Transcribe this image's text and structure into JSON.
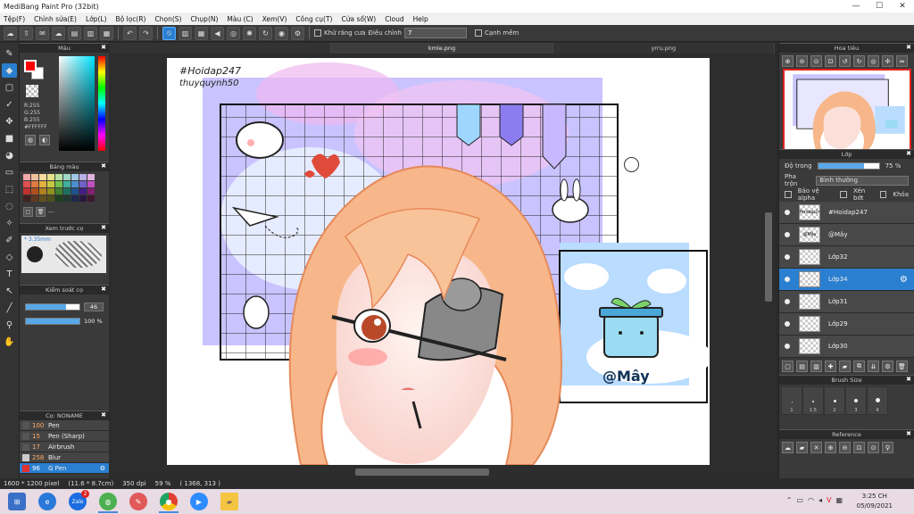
{
  "window": {
    "title": "MediBang Paint Pro (32bit)",
    "min": "—",
    "max": "☐",
    "close": "✕"
  },
  "menu": [
    "Tệp(F)",
    "Chỉnh sửa(E)",
    "Lớp(L)",
    "Bộ lọc(R)",
    "Chọn(S)",
    "Chụp(N)",
    "Màu (C)",
    "Xem(V)",
    "Công cụ(T)",
    "Cửa sổ(W)",
    "Cloud",
    "Help"
  ],
  "toolbar": {
    "antialias_label": "Khử răng cưa",
    "correction_label": "Điều chỉnh",
    "correction_value": "7",
    "snap_label": "Cạnh mềm"
  },
  "tabs": [
    {
      "label": ""
    },
    {
      "label": "kmle.png"
    },
    {
      "label": "yrru.png"
    }
  ],
  "color_panel": {
    "title": "Màu",
    "r": "R:255",
    "g": "G:255",
    "b": "B:255",
    "hex": "#FFFFFF"
  },
  "palette_panel": {
    "title": "Bảng màu",
    "name": "---"
  },
  "preview_panel": {
    "title": "Xem trước cọ",
    "size": "3.35mm"
  },
  "control_panel": {
    "title": "Kiểm soát cọ",
    "size_value": "46",
    "opacity_value": "100 %",
    "size_level": 0.75,
    "opacity_level": 1.0
  },
  "brush_panel": {
    "title": "Cọ: NONAME",
    "items": [
      {
        "size": "100",
        "name": "Pen",
        "color": "#555555",
        "active": false
      },
      {
        "size": "15",
        "name": "Pen (Sharp)",
        "color": "#555555",
        "active": false
      },
      {
        "size": "17",
        "name": "Airbrush",
        "color": "#555555",
        "active": false
      },
      {
        "size": "258",
        "name": "Blur",
        "color": "#cccccc",
        "active": false
      },
      {
        "size": "96",
        "name": "G Pen",
        "color": "#e03030",
        "active": true
      }
    ]
  },
  "artwork": {
    "watermark_1": "#Hoidap247",
    "watermark_2": "thuyquynh50",
    "sticker_text": "@Mây"
  },
  "navigator": {
    "title": "Hoa tiêu"
  },
  "layer_panel": {
    "title": "Lớp",
    "opacity_label": "Độ trong",
    "opacity_value": "75 %",
    "opacity_level": 0.75,
    "blend_label": "Pha trộn",
    "blend_value": "Bình thường",
    "protect_alpha": "Bảo vệ alpha",
    "clipping": "Xén bớt",
    "lock": "Khóa",
    "layers": [
      {
        "name": "#Hoidap247",
        "thumb": "#Hoidap247",
        "active": false
      },
      {
        "name": "@Mây",
        "thumb": "@Mây",
        "active": false
      },
      {
        "name": "Lớp32",
        "thumb": "",
        "active": false
      },
      {
        "name": "Lớp34",
        "thumb": "",
        "active": true
      },
      {
        "name": "Lớp31",
        "thumb": "",
        "active": false
      },
      {
        "name": "Lớp29",
        "thumb": "",
        "active": false
      },
      {
        "name": "Lớp30",
        "thumb": "",
        "active": false
      }
    ]
  },
  "brush_size_panel": {
    "title": "Brush Size",
    "sizes": [
      "1",
      "1.5",
      "2",
      "3",
      "4"
    ]
  },
  "reference_panel": {
    "title": "Reference"
  },
  "status": {
    "size": "1600 * 1200 pixel",
    "physical": "(11.6 * 8.7cm)",
    "dpi": "350 dpi",
    "zoom": "59 %",
    "coords": "( 1368, 313 )"
  },
  "taskbar": {
    "time": "3:25 CH",
    "date": "05/09/2021",
    "zalo_badge": "2"
  },
  "colors": {
    "accent": "#2a7fd0",
    "fg_color": "#ff0000",
    "hair": "#f7b78a",
    "grid_bg": "#c9c3ff"
  }
}
